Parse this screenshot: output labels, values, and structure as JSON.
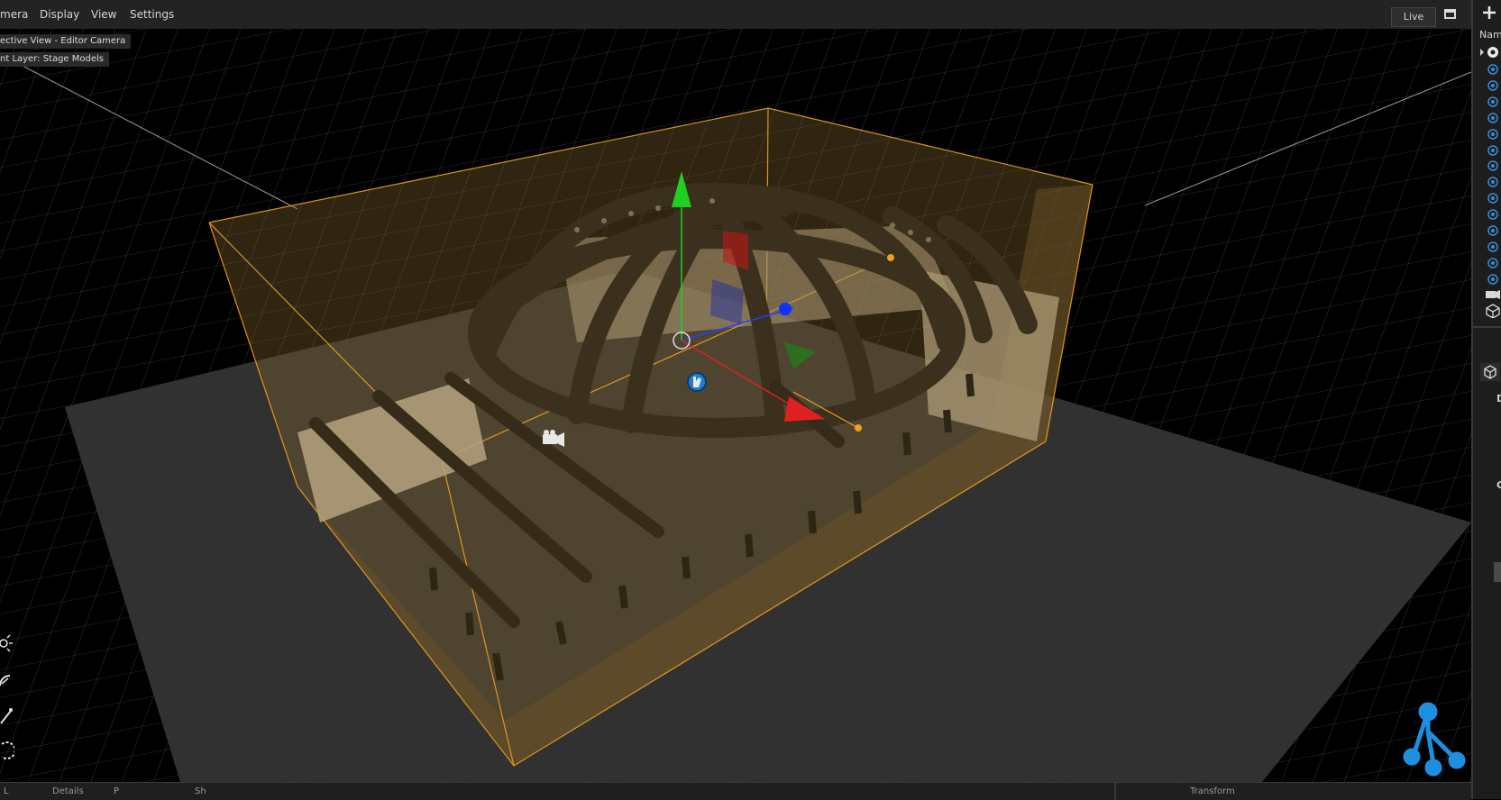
{
  "menu": {
    "items": [
      {
        "label": "mera"
      },
      {
        "label": "Display"
      },
      {
        "label": "View"
      },
      {
        "label": "Settings"
      }
    ],
    "live_label": "Live"
  },
  "viewport": {
    "camera_label": "ective View - Editor Camera",
    "layer_label": "nt Layer: Stage Models"
  },
  "right_panel": {
    "name_header": "Nam",
    "label_d": "D",
    "label_g": "G"
  },
  "bottom_tabs": [
    "L",
    "Details",
    "P",
    "Sh",
    "Transform"
  ],
  "colors": {
    "selection": "#f0a020",
    "axis_x": "#e02020",
    "axis_y": "#20d020",
    "axis_z": "#2040ff",
    "logo": "#1e8fe0"
  }
}
